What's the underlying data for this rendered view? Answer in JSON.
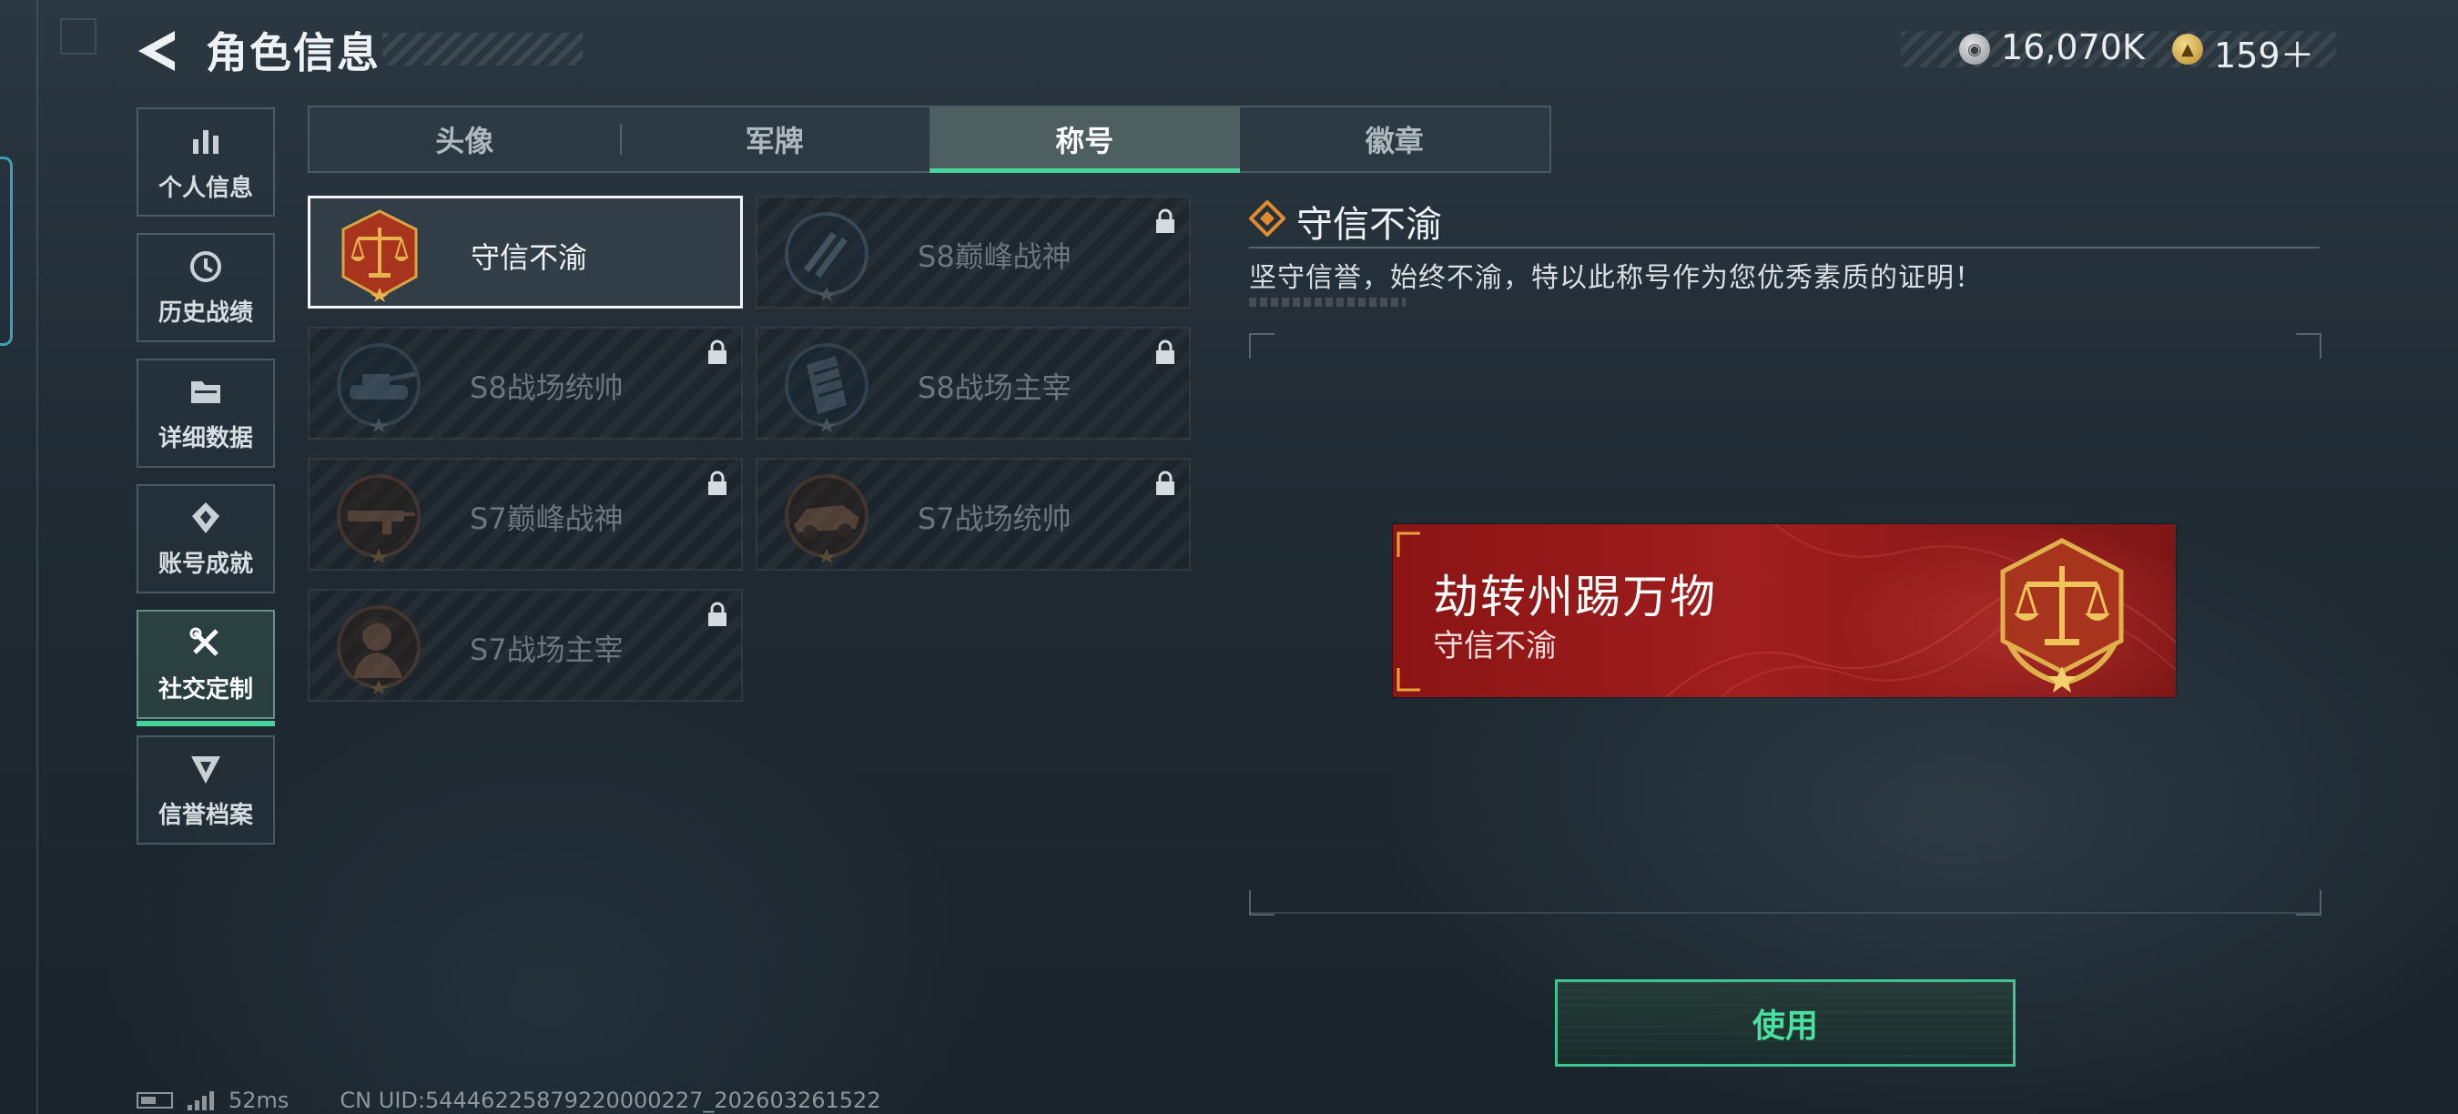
{
  "header": {
    "title": "角色信息",
    "currencies": [
      {
        "icon": "silver-coin-icon",
        "value": "16,070K"
      },
      {
        "icon": "gold-token-icon",
        "value": "159＋"
      }
    ]
  },
  "sidebar": {
    "items": [
      {
        "label": "个人信息",
        "icon": "bar-chart-icon",
        "active": false
      },
      {
        "label": "历史战绩",
        "icon": "history-clock-icon",
        "active": false
      },
      {
        "label": "详细数据",
        "icon": "folder-icon",
        "active": false
      },
      {
        "label": "账号成就",
        "icon": "achievement-icon",
        "active": false
      },
      {
        "label": "社交定制",
        "icon": "tools-icon",
        "active": true
      },
      {
        "label": "信誉档案",
        "icon": "reputation-icon",
        "active": false
      }
    ]
  },
  "tabs": [
    {
      "label": "头像",
      "active": false
    },
    {
      "label": "军牌",
      "active": false
    },
    {
      "label": "称号",
      "active": true
    },
    {
      "label": "徽章",
      "active": false
    }
  ],
  "titles": [
    {
      "name": "守信不渝",
      "emblem": "scales-emblem-icon",
      "locked": false,
      "selected": true
    },
    {
      "name": "S8巅峰战神",
      "emblem": "s8-peak-emblem-icon",
      "locked": true,
      "selected": false
    },
    {
      "name": "S8战场统帅",
      "emblem": "tank-emblem-icon",
      "locked": true,
      "selected": false
    },
    {
      "name": "S8战场主宰",
      "emblem": "building-emblem-icon",
      "locked": true,
      "selected": false
    },
    {
      "name": "S7巅峰战神",
      "emblem": "rifle-emblem-icon",
      "locked": true,
      "selected": false
    },
    {
      "name": "S7战场统帅",
      "emblem": "vehicle-emblem-icon",
      "locked": true,
      "selected": false
    },
    {
      "name": "S7战场主宰",
      "emblem": "soldier-emblem-icon",
      "locked": true,
      "selected": false
    }
  ],
  "detail": {
    "title": "守信不渝",
    "description": "坚守信誉，始终不渝，特以此称号作为您优秀素质的证明！",
    "banner": {
      "player_name": "劫转州踢万物",
      "title": "守信不渝"
    },
    "use_label": "使用"
  },
  "status": {
    "ping": "52ms",
    "uid": "CN UID:54446225879220000227_202603261522"
  },
  "colors": {
    "accent_green": "#46d49a",
    "banner_red": "#9a1c1c",
    "emblem_gold": "#d9a441"
  }
}
